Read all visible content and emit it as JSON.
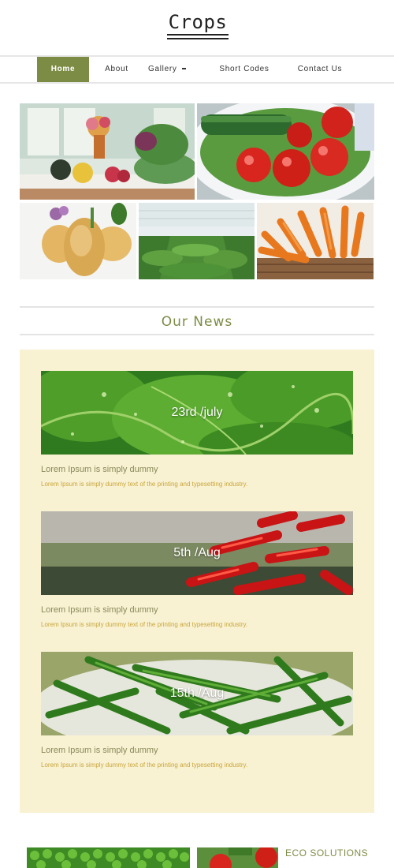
{
  "brand": {
    "name": "Crops"
  },
  "nav": {
    "items": [
      {
        "label": "Home"
      },
      {
        "label": "About"
      },
      {
        "label": "Gallery"
      },
      {
        "label": "Short Codes"
      },
      {
        "label": "Contact Us"
      }
    ],
    "active": "Home"
  },
  "gallery": {
    "images": [
      {
        "icon": "flowers-vegetables-table-photo"
      },
      {
        "icon": "tomatoes-cucumber-bowl-photo"
      },
      {
        "icon": "potatoes-photo"
      },
      {
        "icon": "greenhouse-lettuce-photo"
      },
      {
        "icon": "carrots-basket-photo"
      }
    ]
  },
  "news": {
    "title": "Our News",
    "items": [
      {
        "date": "23rd /july",
        "title": "Lorem Ipsum is simply dummy",
        "text": "Lorem Ipsum is simply dummy text of the printing and typesetting industry.",
        "icon": "lettuce-leaves-photo"
      },
      {
        "date": "5th /Aug",
        "title": "Lorem Ipsum is simply dummy",
        "text": "Lorem Ipsum is simply dummy text of the printing and typesetting industry.",
        "icon": "red-chillies-photo"
      },
      {
        "date": "15th /Aug",
        "title": "Lorem Ipsum is simply dummy",
        "text": "Lorem Ipsum is simply dummy text of the printing and typesetting industry.",
        "icon": "green-beans-photo"
      }
    ]
  },
  "bottom": {
    "heading": "ECO SOLUTIONS",
    "images": [
      {
        "icon": "green-peas-photo"
      },
      {
        "icon": "tomatoes-photo"
      }
    ]
  },
  "colors": {
    "accent": "#7d8c45",
    "panel": "#f8f1d2",
    "desc": "#c9a63c"
  }
}
